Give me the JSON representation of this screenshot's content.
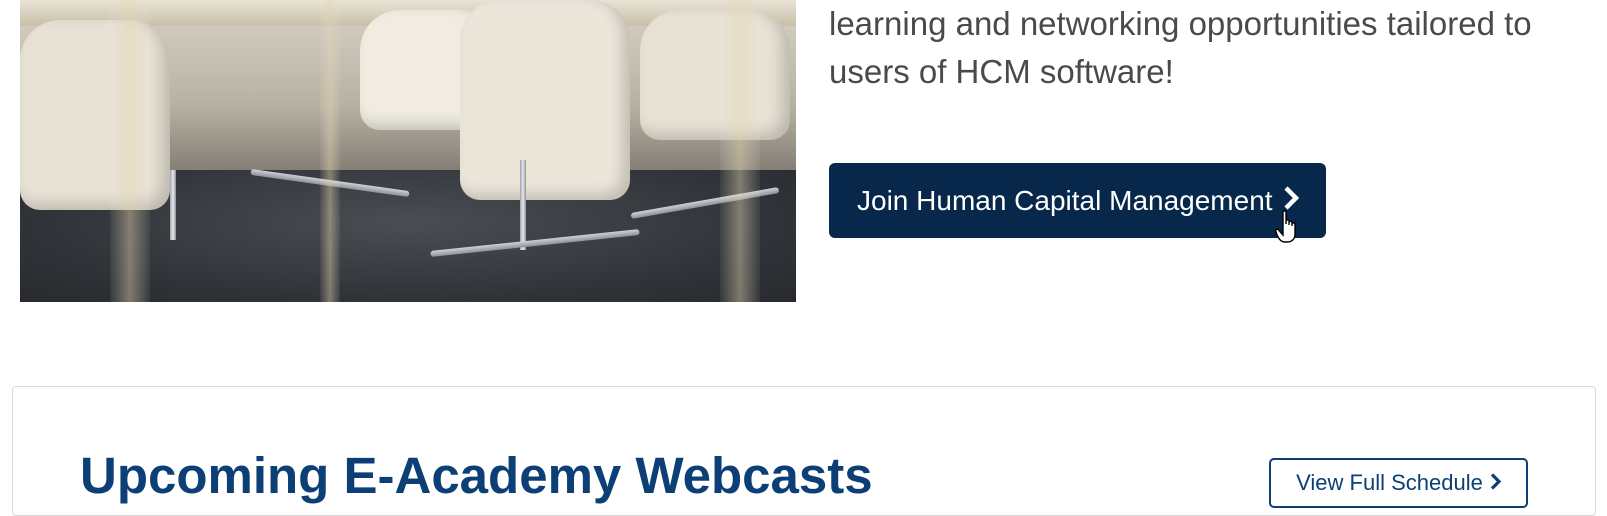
{
  "intro": {
    "line1": "learning and networking opportunities tailored to",
    "line2": "users of HCM software!"
  },
  "join_button": {
    "label": "Join Human Capital Management",
    "icon": "chevron-right-icon"
  },
  "webcasts": {
    "title": "Upcoming E-Academy Webcasts",
    "schedule_button_label": "View Full Schedule",
    "schedule_button_icon": "chevron-right-icon"
  },
  "colors": {
    "primary_navy": "#07284b",
    "title_blue": "#0c3f75",
    "body_text": "#4a4a4a"
  }
}
